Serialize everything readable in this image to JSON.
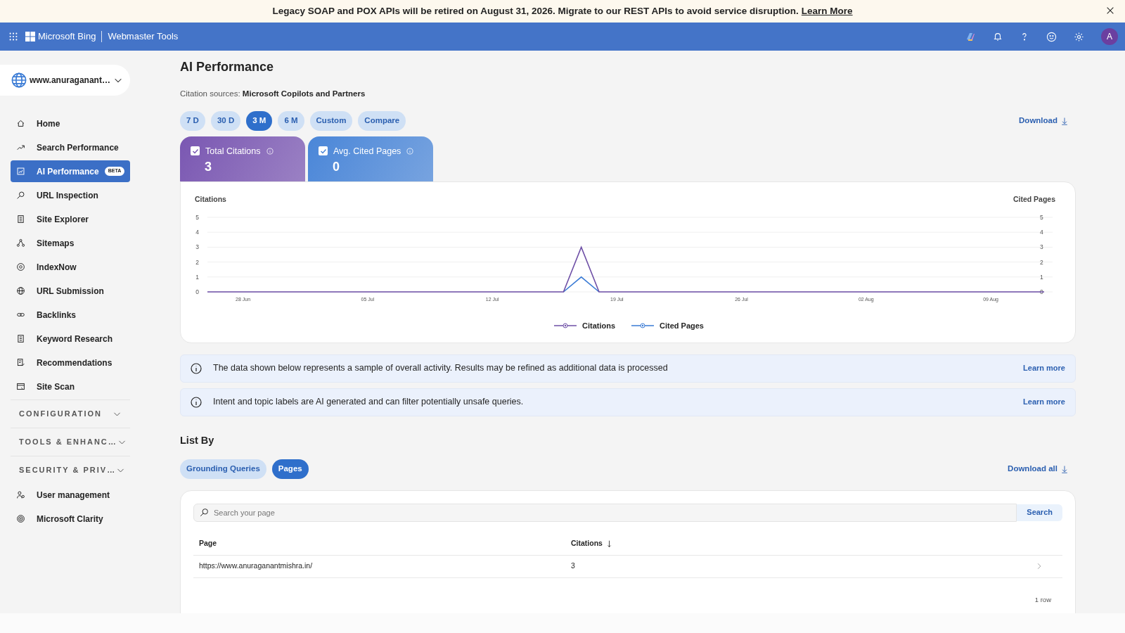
{
  "banner": {
    "message": "Legacy SOAP and POX APIs will be retired on August 31, 2026. Migrate to our REST APIs to avoid service disruption.",
    "link": "Learn More"
  },
  "navbar": {
    "brand": "Microsoft Bing",
    "product": "Webmaster Tools",
    "avatar": "A"
  },
  "sidebar": {
    "site": "www.anuraganant…",
    "items": [
      {
        "kind": "link",
        "label": "Home",
        "selected": false
      },
      {
        "kind": "link",
        "label": "Search Performance",
        "selected": false
      },
      {
        "kind": "link",
        "label": "AI Performance",
        "selected": true,
        "badge": "BETA"
      },
      {
        "kind": "link",
        "label": "URL Inspection",
        "selected": false
      },
      {
        "kind": "link",
        "label": "Site Explorer",
        "selected": false
      },
      {
        "kind": "link",
        "label": "Sitemaps",
        "selected": false
      },
      {
        "kind": "link",
        "label": "IndexNow",
        "selected": false
      },
      {
        "kind": "link",
        "label": "URL Submission",
        "selected": false
      },
      {
        "kind": "link",
        "label": "Backlinks",
        "selected": false
      },
      {
        "kind": "link",
        "label": "Keyword Research",
        "selected": false
      },
      {
        "kind": "link",
        "label": "Recommendations",
        "selected": false
      },
      {
        "kind": "link",
        "label": "Site Scan",
        "selected": false
      },
      {
        "kind": "section",
        "label": "CONFIGURATION",
        "expanded": false
      },
      {
        "kind": "section",
        "label": "TOOLS & ENHANC…",
        "expanded": false
      },
      {
        "kind": "section",
        "label": "SECURITY & PRIV…",
        "expanded": false
      },
      {
        "kind": "link",
        "label": "User management",
        "selected": false
      },
      {
        "kind": "link",
        "label": "Microsoft Clarity",
        "selected": false
      }
    ]
  },
  "page": {
    "title": "AI Performance",
    "sources_label": "Citation sources:",
    "sources": "Microsoft Copilots and Partners"
  },
  "ranges": [
    {
      "label": "7 D",
      "selected": false
    },
    {
      "label": "30 D",
      "selected": false
    },
    {
      "label": "3 M",
      "selected": true
    },
    {
      "label": "6 M",
      "selected": false
    },
    {
      "label": "Custom",
      "selected": false
    },
    {
      "label": "Compare",
      "selected": false
    }
  ],
  "download": "Download",
  "metrics": [
    {
      "label": "Total Citations",
      "value": "3",
      "checked": true,
      "color": "#7a57b2"
    },
    {
      "label": "Avg. Cited Pages",
      "value": "0",
      "checked": true,
      "color": "#4a86d8"
    }
  ],
  "chart": {
    "chart_data": {
      "type": "line",
      "ylabel": "Citations",
      "y2label": "Cited Pages",
      "categories": [
        null,
        null,
        "28 Jun",
        null,
        null,
        null,
        null,
        null,
        null,
        "05 Jul",
        null,
        null,
        null,
        null,
        null,
        null,
        "12 Jul",
        null,
        null,
        null,
        null,
        null,
        null,
        "19 Jul",
        null,
        null,
        null,
        null,
        null,
        null,
        "26 Jul",
        null,
        null,
        null,
        null,
        null,
        null,
        "02 Aug",
        null,
        null,
        null,
        null,
        null,
        null,
        "09 Aug",
        null,
        null,
        null
      ],
      "series": [
        {
          "name": "Citations",
          "color": "#6e4fa6",
          "values": [
            0,
            0,
            0,
            0,
            0,
            0,
            0,
            0,
            0,
            0,
            0,
            0,
            0,
            0,
            0,
            0,
            0,
            0,
            0,
            0,
            0,
            3,
            0,
            0,
            0,
            0,
            0,
            0,
            0,
            0,
            0,
            0,
            0,
            0,
            0,
            0,
            0,
            0,
            0,
            0,
            0,
            0,
            0,
            0,
            0,
            0,
            0,
            0
          ]
        },
        {
          "name": "Cited Pages",
          "color": "#3a7bd5",
          "values": [
            null,
            null,
            null,
            null,
            null,
            null,
            null,
            null,
            null,
            null,
            null,
            null,
            null,
            null,
            null,
            null,
            null,
            null,
            null,
            null,
            0,
            1,
            0,
            null,
            null,
            null,
            null,
            null,
            null,
            null,
            null,
            null,
            null,
            null,
            null,
            null,
            null,
            null,
            null,
            null,
            null,
            null,
            null,
            null,
            null,
            null,
            null,
            null
          ]
        }
      ],
      "ylim": [
        0,
        5
      ],
      "yticks": [
        0,
        1,
        2,
        3,
        4,
        5
      ],
      "y2lim": [
        0,
        5
      ],
      "y2ticks": [
        0,
        1,
        2,
        3,
        4,
        5
      ],
      "grid": true,
      "legend": "bottom"
    }
  },
  "notices": [
    {
      "text": "The data shown below represents a sample of overall activity. Results may be refined as additional data is processed",
      "link": "Learn more"
    },
    {
      "text": "Intent and topic labels are AI generated and can filter potentially unsafe queries.",
      "link": "Learn more"
    }
  ],
  "list_by": {
    "title": "List By",
    "tabs": [
      {
        "label": "Grounding Queries",
        "selected": false
      },
      {
        "label": "Pages",
        "selected": true
      }
    ],
    "download": "Download all"
  },
  "table": {
    "search": {
      "placeholder": "Search your page",
      "button": "Search"
    },
    "columns": [
      {
        "label": "Page"
      },
      {
        "label": "Citations",
        "sorted": true
      }
    ],
    "rows": [
      [
        "https://www.anuraganantmishra.in/",
        "3"
      ]
    ],
    "footer": "1 row"
  }
}
